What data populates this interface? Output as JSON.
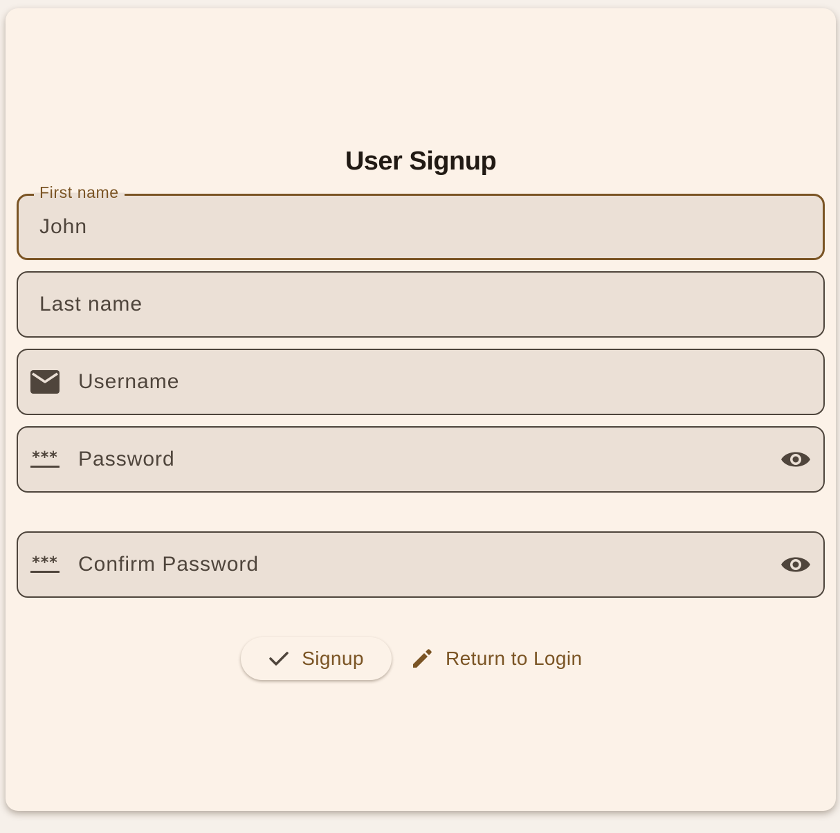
{
  "page": {
    "title": "User Signup"
  },
  "form": {
    "first_name": {
      "label": "First name",
      "value": "John"
    },
    "last_name": {
      "placeholder": "Last name"
    },
    "username": {
      "placeholder": "Username",
      "icon": "envelope-icon"
    },
    "password": {
      "placeholder": "Password",
      "icon": "password-icon",
      "toggle_icon": "eye-icon"
    },
    "confirm_password": {
      "placeholder": "Confirm Password",
      "icon": "password-icon",
      "toggle_icon": "eye-icon"
    }
  },
  "actions": {
    "signup_label": "Signup",
    "signup_icon": "check-icon",
    "return_label": "Return to Login",
    "return_icon": "pencil-icon"
  },
  "colors": {
    "card_background": "#fcf2e8",
    "field_background": "#ebe0d6",
    "accent": "#7a5424",
    "text": "#4f453c",
    "title": "#211a14"
  }
}
